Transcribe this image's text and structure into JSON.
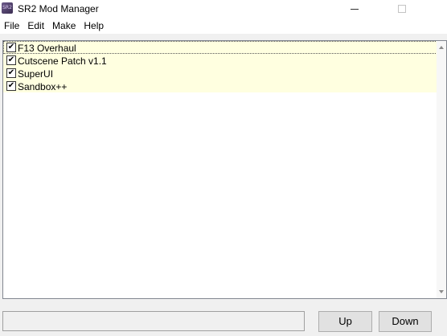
{
  "window": {
    "title": "SR2 Mod Manager",
    "icon": "app-icon",
    "icon_text": "SR2"
  },
  "menu": {
    "items": [
      "File",
      "Edit",
      "Make",
      "Help"
    ]
  },
  "mods": [
    {
      "label": "F13 Overhaul",
      "checked": true
    },
    {
      "label": "Cutscene Patch v1.1",
      "checked": true
    },
    {
      "label": "SuperUI",
      "checked": true
    },
    {
      "label": "Sandbox++",
      "checked": true
    }
  ],
  "buttons": {
    "up": "Up",
    "down": "Down"
  },
  "status_text": ""
}
